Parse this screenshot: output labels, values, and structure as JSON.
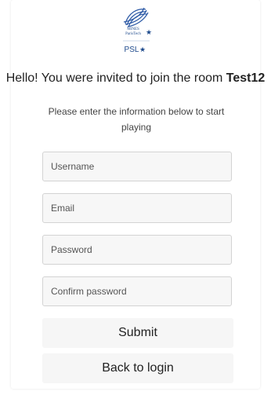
{
  "logo": {
    "top_text": "MINES",
    "sub_text": "ParisTech",
    "psl_text": "PSL"
  },
  "header": {
    "greeting": "Hello! You were invited to join the room ",
    "room_name": "Test12",
    "instructions": "Please enter the information below to start playing"
  },
  "form": {
    "username_placeholder": "Username",
    "email_placeholder": "Email",
    "password_placeholder": "Password",
    "confirm_password_placeholder": "Confirm password",
    "submit_label": "Submit",
    "back_label": "Back to login"
  },
  "colors": {
    "logo_blue": "#1e4a8c",
    "field_background": "#f7f7f7",
    "button_background": "#f6f6f6"
  },
  "icons": [
    "mines-paristech-logo",
    "psl-star-icon"
  ]
}
